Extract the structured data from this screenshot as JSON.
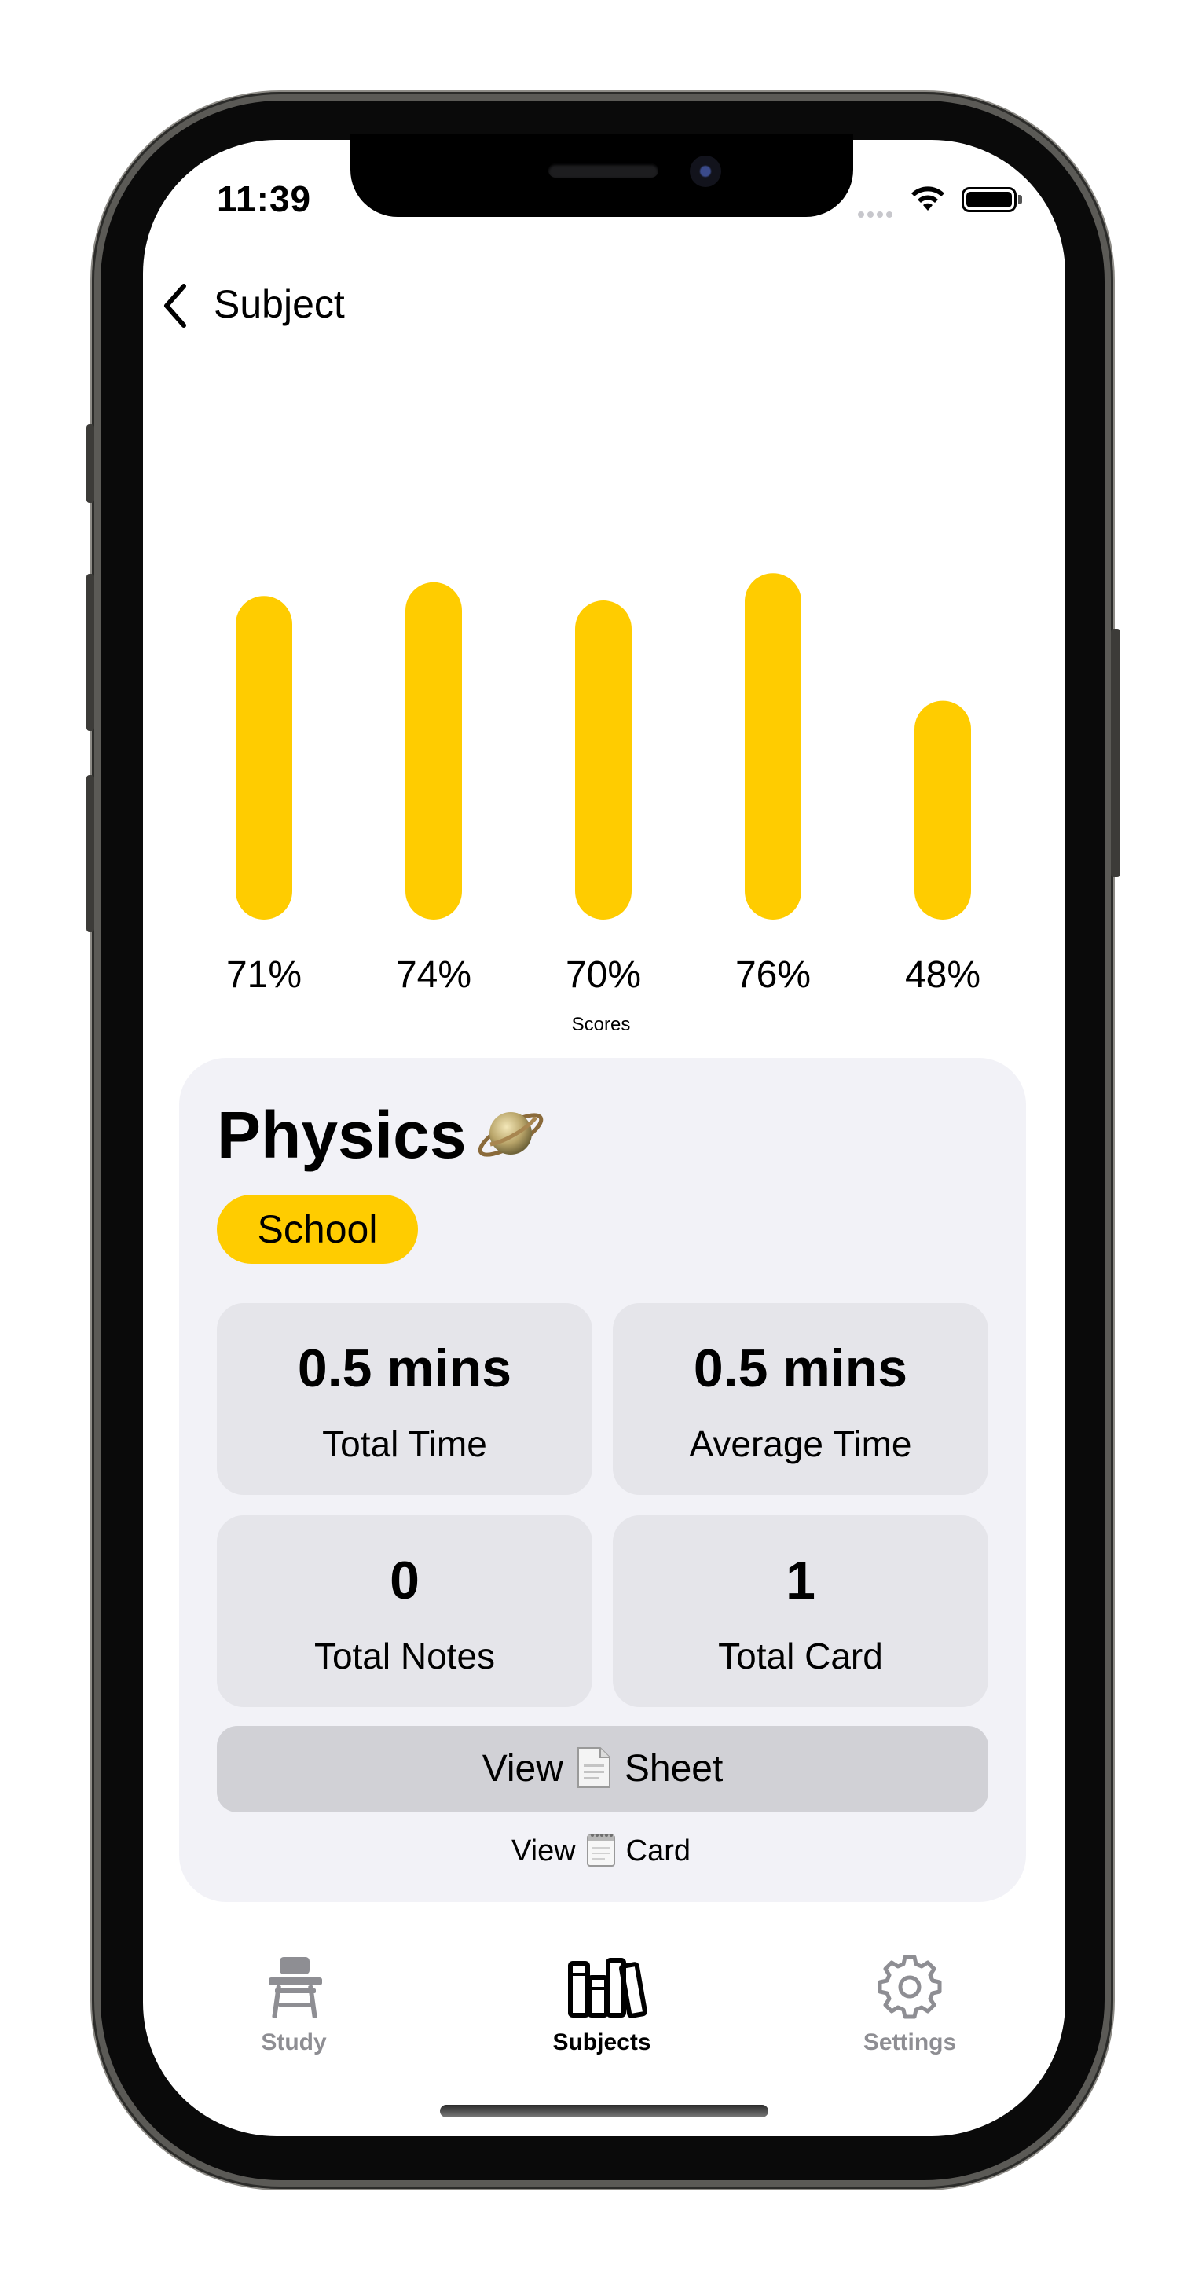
{
  "status_bar": {
    "time": "11:39"
  },
  "nav": {
    "back_label": "Subject"
  },
  "chart_data": {
    "type": "bar",
    "categories": [
      "",
      "",
      "",
      "",
      ""
    ],
    "values": [
      71,
      74,
      70,
      76,
      48
    ],
    "value_labels": [
      "71%",
      "74%",
      "70%",
      "76%",
      "48%"
    ],
    "xlabel": "Scores",
    "ylabel": "",
    "ylim": [
      0,
      100
    ],
    "grid": false,
    "bar_color": "#ffcc00"
  },
  "subject": {
    "title": "Physics",
    "emoji_icon": "ringed-planet-icon",
    "tag": "School"
  },
  "stats": [
    {
      "value": "0.5 mins",
      "label": "Total Time"
    },
    {
      "value": "0.5 mins",
      "label": "Average Time"
    },
    {
      "value": "0",
      "label": "Total Notes"
    },
    {
      "value": "1",
      "label": "Total Card"
    }
  ],
  "actions": {
    "view_sheet": {
      "left": "View",
      "right": "Sheet",
      "icon": "document-icon"
    },
    "view_card": {
      "left": "View",
      "right": "Card",
      "icon": "notepad-icon"
    }
  },
  "tab_bar": {
    "items": [
      {
        "label": "Study",
        "icon": "school-desk-icon",
        "active": false
      },
      {
        "label": "Subjects",
        "icon": "books-icon",
        "active": true
      },
      {
        "label": "Settings",
        "icon": "gear-icon",
        "active": false
      }
    ]
  },
  "colors": {
    "accent": "#ffcc00",
    "card_bg": "#f2f2f7",
    "stat_bg": "#e5e5ea",
    "button_bg": "#d1d1d6",
    "inactive_tab": "#8e8e93"
  }
}
